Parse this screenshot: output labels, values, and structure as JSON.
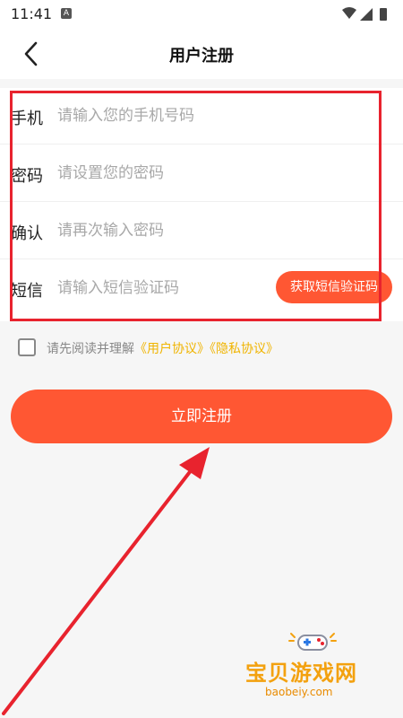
{
  "status_bar": {
    "time": "11:41",
    "notification_badge": "A"
  },
  "header": {
    "title": "用户注册",
    "back_icon": "chevron-left-icon"
  },
  "form": {
    "phone": {
      "label": "手机",
      "placeholder": "请输入您的手机号码",
      "value": ""
    },
    "password": {
      "label": "密码",
      "placeholder": "请设置您的密码",
      "value": ""
    },
    "confirm": {
      "label": "确认",
      "placeholder": "请再次输入密码",
      "value": ""
    },
    "sms": {
      "label": "短信",
      "placeholder": "请输入短信验证码",
      "value": "",
      "get_code_label": "获取短信验证码"
    }
  },
  "agreement": {
    "prefix": "请先阅读并理解",
    "user_agreement": "《用户协议》",
    "privacy_agreement": "《隐私协议》",
    "checked": false
  },
  "register_label": "立即注册",
  "watermark": {
    "text": "宝贝游戏网",
    "url": "baobeiy.com"
  },
  "colors": {
    "accent": "#ff5733",
    "annotation": "#e8232e",
    "link": "#f0b400"
  }
}
